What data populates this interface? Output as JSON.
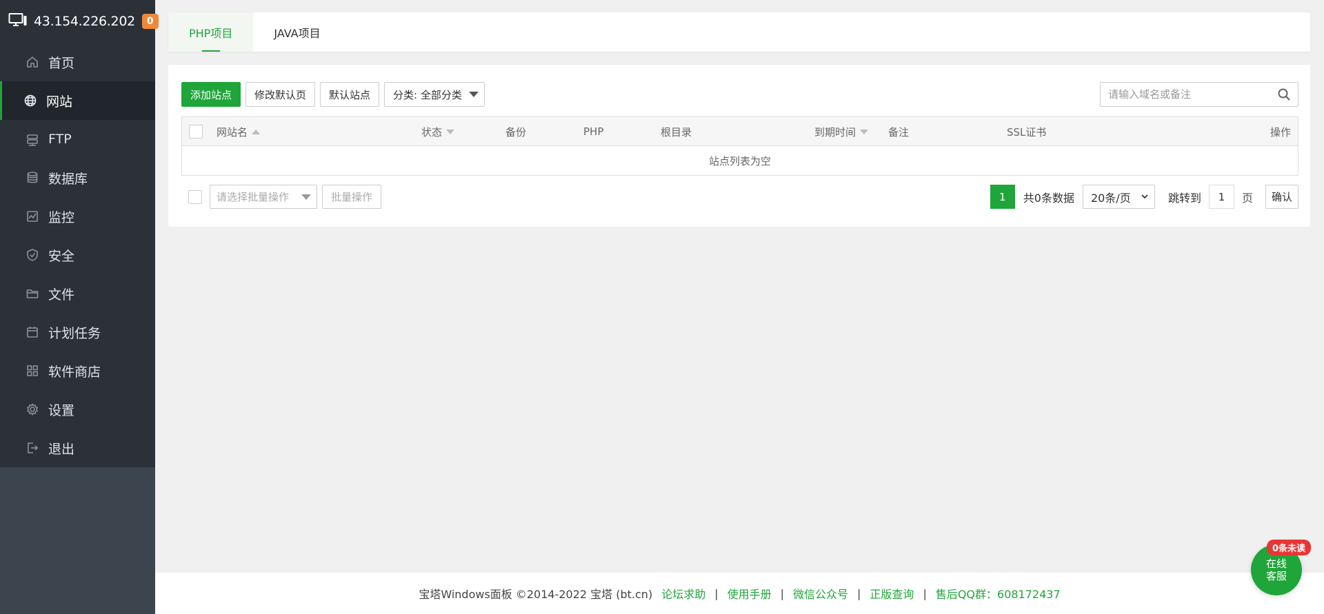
{
  "server": {
    "ip": "43.154.226.202",
    "badge": "0"
  },
  "sidebar": {
    "items": [
      {
        "label": "首页",
        "icon": "home-icon"
      },
      {
        "label": "网站",
        "icon": "globe-icon",
        "active": true
      },
      {
        "label": "FTP",
        "icon": "ftp-icon"
      },
      {
        "label": "数据库",
        "icon": "database-icon"
      },
      {
        "label": "监控",
        "icon": "monitor-icon"
      },
      {
        "label": "安全",
        "icon": "shield-icon"
      },
      {
        "label": "文件",
        "icon": "folder-icon"
      },
      {
        "label": "计划任务",
        "icon": "calendar-icon"
      },
      {
        "label": "软件商店",
        "icon": "apps-icon"
      },
      {
        "label": "设置",
        "icon": "gear-icon"
      },
      {
        "label": "退出",
        "icon": "logout-icon"
      }
    ]
  },
  "tabs": [
    {
      "label": "PHP项目",
      "active": true
    },
    {
      "label": "JAVA项目"
    }
  ],
  "toolbar": {
    "add_site": "添加站点",
    "edit_default_page": "修改默认页",
    "default_site": "默认站点",
    "category": "分类: 全部分类"
  },
  "search": {
    "placeholder": "请输入域名或备注"
  },
  "table": {
    "columns": {
      "name": "网站名",
      "status": "状态",
      "backup": "备份",
      "php": "PHP",
      "root": "根目录",
      "expire": "到期时间",
      "note": "备注",
      "ssl": "SSL证书",
      "actions": "操作"
    },
    "empty_text": "站点列表为空"
  },
  "batch": {
    "select_placeholder": "请选择批量操作",
    "button": "批量操作"
  },
  "pager": {
    "current": "1",
    "total": "共0条数据",
    "per_page": "20条/页",
    "goto_label": "跳转到",
    "goto_value": "1",
    "page_label": "页",
    "confirm": "确认"
  },
  "footer": {
    "copyright": "宝塔Windows面板 ©2014-2022 宝塔 (bt.cn)",
    "links": [
      "论坛求助",
      "使用手册",
      "微信公众号",
      "正版查询",
      "售后QQ群：608172437"
    ]
  },
  "chat": {
    "badge": "0条未读",
    "line1": "在线",
    "line2": "客服"
  },
  "colors": {
    "accent": "#20a53a",
    "sidebar": "#3c444d",
    "badge": "#f0883a",
    "alert": "#e83535"
  }
}
